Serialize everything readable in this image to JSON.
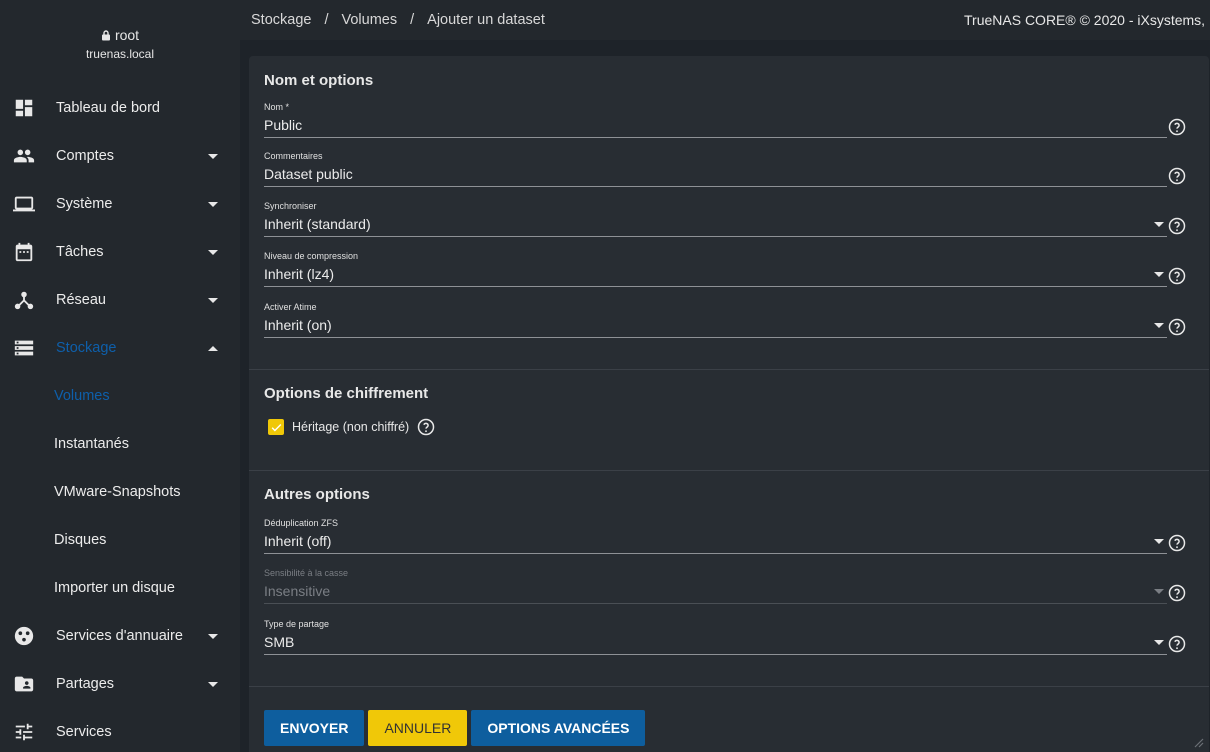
{
  "user": {
    "name": "root",
    "host": "truenas.local"
  },
  "nav": [
    {
      "label": "Tableau de bord",
      "icon": "dashboard-icon",
      "caret": ""
    },
    {
      "label": "Comptes",
      "icon": "people-icon",
      "caret": "down"
    },
    {
      "label": "Système",
      "icon": "laptop-icon",
      "caret": "down"
    },
    {
      "label": "Tâches",
      "icon": "calendar-icon",
      "caret": "down"
    },
    {
      "label": "Réseau",
      "icon": "network-icon",
      "caret": "down"
    },
    {
      "label": "Stockage",
      "icon": "storage-icon",
      "caret": "up"
    }
  ],
  "nav_sub": [
    {
      "label": "Volumes"
    },
    {
      "label": "Instantanés"
    },
    {
      "label": "VMware-Snapshots"
    },
    {
      "label": "Disques"
    },
    {
      "label": "Importer un disque"
    }
  ],
  "nav_bottom": [
    {
      "label": "Services d'annuaire",
      "icon": "directory-icon",
      "caret": "down"
    },
    {
      "label": "Partages",
      "icon": "shares-folder-icon",
      "caret": "down"
    },
    {
      "label": "Services",
      "icon": "sliders-icon",
      "caret": ""
    }
  ],
  "breadcrumb": {
    "c1": "Stockage",
    "c2": "Volumes",
    "c3": "Ajouter un dataset",
    "sep": "/"
  },
  "copyright": "TrueNAS CORE® © 2020 - iXsystems, Inc.",
  "sections": {
    "name": "Nom et options",
    "encryption": "Options de chiffrement",
    "other": "Autres options"
  },
  "fields": {
    "name": {
      "label": "Nom *",
      "value": "Public"
    },
    "comments": {
      "label": "Commentaires",
      "value": "Dataset public"
    },
    "sync": {
      "label": "Synchroniser",
      "value": "Inherit (standard)"
    },
    "compression": {
      "label": "Niveau de compression",
      "value": "Inherit (lz4)"
    },
    "atime": {
      "label": "Activer Atime",
      "value": "Inherit (on)"
    },
    "dedup": {
      "label": "Déduplication ZFS",
      "value": "Inherit (off)"
    },
    "case": {
      "label": "Sensibilité à la casse",
      "value": "Insensitive"
    },
    "share": {
      "label": "Type de partage",
      "value": "SMB"
    }
  },
  "encryption_checkbox": {
    "label": "Héritage (non chiffré)",
    "checked": true
  },
  "buttons": {
    "submit": "ENVOYER",
    "cancel": "ANNULER",
    "advanced": "OPTIONS AVANCÉES"
  },
  "colors": {
    "accent": "#0e5faa",
    "warning": "#f0c808",
    "sidebar": "#23282d",
    "card": "#282d33"
  }
}
